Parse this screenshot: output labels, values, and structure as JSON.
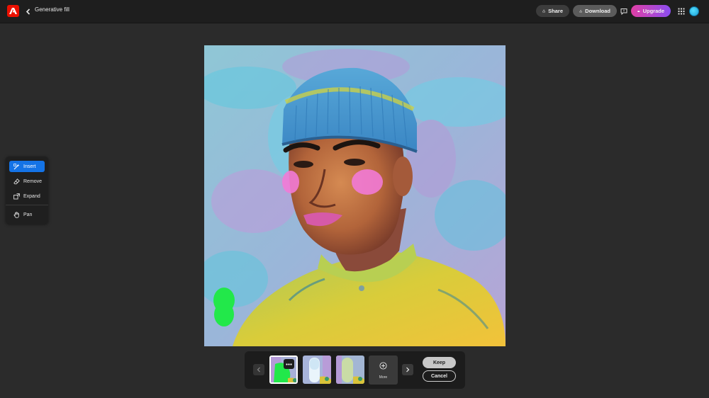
{
  "header": {
    "title": "Generative fill",
    "share_label": "Share",
    "download_label": "Download",
    "upgrade_label": "Upgrade"
  },
  "tools": {
    "items": [
      {
        "label": "Insert",
        "icon": "insert-brush-icon",
        "active": true
      },
      {
        "label": "Remove",
        "icon": "eraser-icon",
        "active": false
      },
      {
        "label": "Expand",
        "icon": "expand-icon",
        "active": false
      },
      {
        "label": "Pan",
        "icon": "hand-icon",
        "active": false
      }
    ]
  },
  "canvas": {
    "image": "generated-portrait-man-blue-beanie-yellow-sweater"
  },
  "variations": {
    "count_shown": 3,
    "selected_index": 0,
    "more_label": "More",
    "keep_label": "Keep",
    "cancel_label": "Cancel"
  },
  "colors": {
    "accent": "#1473e6",
    "adobe_red": "#eb1000",
    "upgrade_start": "#e03fa5",
    "upgrade_end": "#8a4df0",
    "background": "#2b2b2b",
    "topbar": "#1e1e1e"
  }
}
